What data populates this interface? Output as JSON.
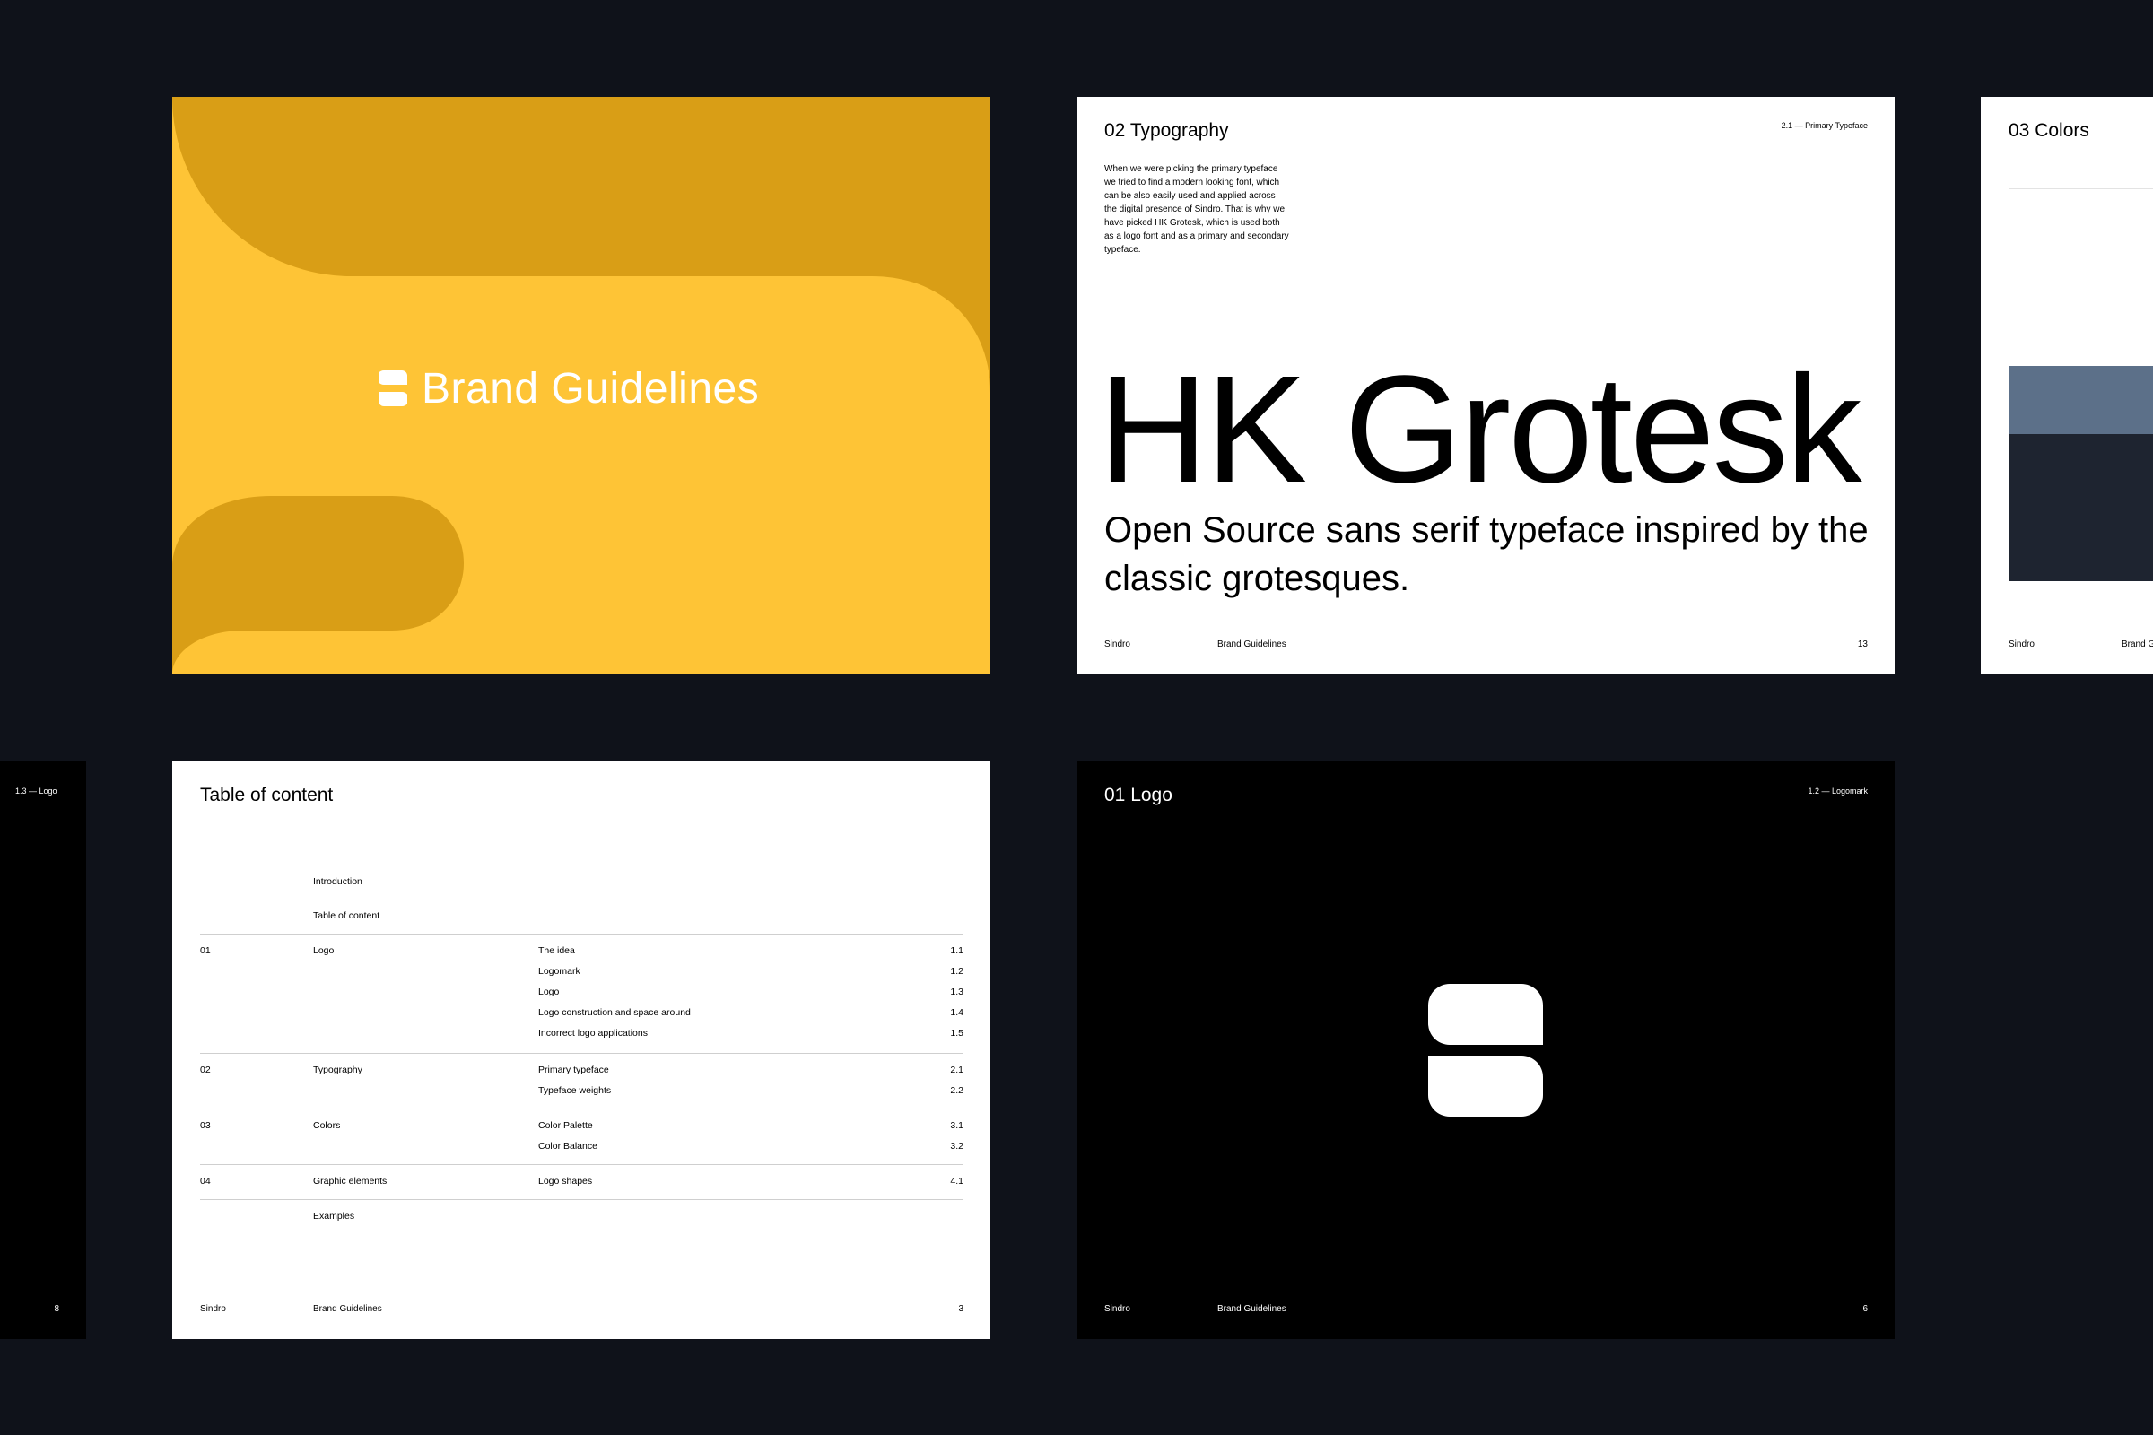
{
  "cover": {
    "title": "Brand Guidelines",
    "colors": {
      "background": "#fec436",
      "shape": "#d99e16"
    }
  },
  "typography_slide": {
    "heading": "02 Typography",
    "breadcrumb": "2.1 — Primary Typeface",
    "body": [
      "When we were picking the primary typeface",
      "we tried to find a modern looking font, which",
      "can be also easily used and applied across",
      "the digital presence of Sindro. That is why we",
      "have picked HK Grotesk, which is used both",
      "as a logo font and as a primary and secondary",
      "typeface."
    ],
    "display": "HK Grotesk",
    "subline": "Open Source sans serif typeface inspired by the classic grotesques.",
    "footer": {
      "brand": "Sindro",
      "doc": "Brand Guidelines",
      "page": "13"
    }
  },
  "colors_slide": {
    "heading": "03 Colors",
    "swatches": [
      "#ffffff",
      "#5c7089",
      "#1e2430"
    ],
    "footer": {
      "brand": "Sindro",
      "doc": "Brand G"
    }
  },
  "left_slide": {
    "breadcrumb": "1.3 — Logo",
    "page": "8"
  },
  "toc_slide": {
    "heading": "Table of content",
    "intro": "Introduction",
    "toc_label": "Table of content",
    "sections": [
      {
        "num": "01",
        "name": "Logo",
        "items": [
          {
            "label": "The idea",
            "ref": "1.1"
          },
          {
            "label": "Logomark",
            "ref": "1.2"
          },
          {
            "label": "Logo",
            "ref": "1.3"
          },
          {
            "label": "Logo construction and space around",
            "ref": "1.4"
          },
          {
            "label": "Incorrect logo applications",
            "ref": "1.5"
          }
        ]
      },
      {
        "num": "02",
        "name": "Typography",
        "items": [
          {
            "label": "Primary typeface",
            "ref": "2.1"
          },
          {
            "label": "Typeface weights",
            "ref": "2.2"
          }
        ]
      },
      {
        "num": "03",
        "name": "Colors",
        "items": [
          {
            "label": "Color Palette",
            "ref": "3.1"
          },
          {
            "label": "Color Balance",
            "ref": "3.2"
          }
        ]
      },
      {
        "num": "04",
        "name": "Graphic elements",
        "items": [
          {
            "label": "Logo shapes",
            "ref": "4.1"
          }
        ]
      }
    ],
    "examples": "Examples",
    "footer": {
      "brand": "Sindro",
      "doc": "Brand Guidelines",
      "page": "3"
    }
  },
  "logo_slide": {
    "heading": "01 Logo",
    "breadcrumb": "1.2 — Logomark",
    "footer": {
      "brand": "Sindro",
      "doc": "Brand Guidelines",
      "page": "6"
    }
  },
  "colors_theme": {
    "page_bg": "#0f121a"
  }
}
